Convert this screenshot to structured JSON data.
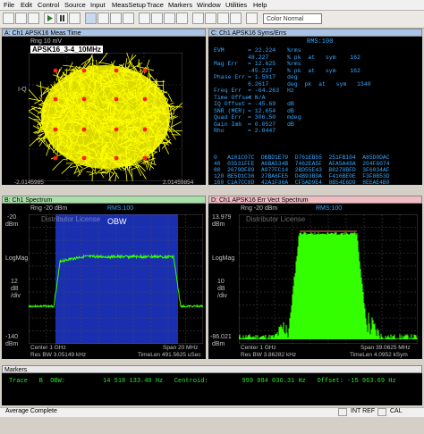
{
  "menu": [
    "File",
    "Edit",
    "Control",
    "Source",
    "Input",
    "MeasSetup",
    "Trace",
    "Markers",
    "Window",
    "Utilities",
    "Help"
  ],
  "toolbar": {
    "color_select": "Color Normal"
  },
  "pane_a": {
    "title": "A: Ch1 APSK16 Meas Time",
    "rng": "Rng 10 mV",
    "label": "APSK16_3-4_10MHz",
    "ylabel": "I-Q",
    "x_left": "-2.0145985",
    "x_right": "2.01459854"
  },
  "pane_c": {
    "title": "C: Ch1 APSK16 Syms/Errs",
    "rms": "RMS:100",
    "metrics": [
      {
        "name": "EVM",
        "value": "= 22.224",
        "unit": "%rms"
      },
      {
        "name": "",
        "value": "48.227",
        "unit": "% pk  at   sym    162"
      },
      {
        "name": "Mag Err",
        "value": "= 12.625",
        "unit": "%rms"
      },
      {
        "name": "",
        "value": "-45.227",
        "unit": "% pk  at   sym    162"
      },
      {
        "name": "Phase Err",
        "value": "= 1.5917",
        "unit": "deg"
      },
      {
        "name": "",
        "value": "6.2617",
        "unit": "deg  pk  at   sym   1340"
      },
      {
        "name": "Freq Err",
        "value": "= -64.263",
        "unit": "Hz"
      },
      {
        "name": "Time Offset",
        "value": "= N/A",
        "unit": ""
      },
      {
        "name": "IQ Offset",
        "value": "= -45.69",
        "unit": "dB"
      },
      {
        "name": "SNR (MER)",
        "value": "= 12.654",
        "unit": "dB"
      },
      {
        "name": "Quad Err",
        "value": "= 306.50",
        "unit": "mdeg"
      },
      {
        "name": "Gain Imb",
        "value": "= 0.0527",
        "unit": "dB"
      },
      {
        "name": "Rho",
        "value": "= 2.8447",
        "unit": ""
      }
    ],
    "symbols": [
      "0   A101C07C  DBBD1E79  D761EB55  251FB104  A85D0DAC",
      "40  03531FFE  A6BA534B  7462EA5F  AFA5A48A  204F6074",
      "80  2679DF89  A977FC14  2BD55E43  B8278BFD  3F6034AF",
      "120 BE5D1C36  27BA6FE5  D4B93B9A  F416BE0E  F3F8B53D",
      "160 C1A7CC8D  42A1F36A  CF5AD9E4  8B54E6D9  8EEAE4B0"
    ]
  },
  "pane_b": {
    "title": "B: Ch1 Spectrum",
    "rng": "Rng -20 dBm",
    "rms": "RMS:100",
    "license": "Distributor License",
    "obw": "OBW",
    "y_top": "-20",
    "y_top_unit": "dBm",
    "y_mid_label": "LogMag",
    "y_div": "12",
    "y_div_unit": "dB\n/div",
    "y_bottom": "-140",
    "y_bottom_unit": "dBm",
    "center": "Center 1 GHz",
    "span": "Span 20 MHz",
    "res_bw": "Res BW 3.05149 kHz",
    "time_len": "TimeLen 491.5625 uSec"
  },
  "pane_d": {
    "title": "D: Ch1 APSK16 Err Vect Spectrum",
    "rng": "Rng -20 dBm",
    "rms": "RMS:100",
    "license": "Distributor License",
    "y_top": "13.979",
    "y_top_unit": "dBm",
    "y_mid_label": "LogMag",
    "y_div": "10",
    "y_div_unit": "dB\n/div",
    "y_bottom": "-86.021",
    "y_bottom_unit": "dBm",
    "center": "Center 1 GHz",
    "span": "Span 39.0625 MHz",
    "res_bw": "Res BW 3.86282 kHz",
    "time_len": "TimeLen 4.0952 kSym"
  },
  "markers": {
    "title": "Markers",
    "line": "Trace   B  OBW:          14 518 133.40 Hz   Centroid:         999 984 036.31 Hz   Offset: -15 963.69 Hz"
  },
  "status": {
    "left": "Average Complete",
    "int_ref": "INT REF",
    "cal": "CAL"
  },
  "colors": {
    "trace_yellow": "#ffff00",
    "trace_green": "#33ff00",
    "obw_blue": "#1a2fb0",
    "symbol_red": "#ff2020"
  }
}
